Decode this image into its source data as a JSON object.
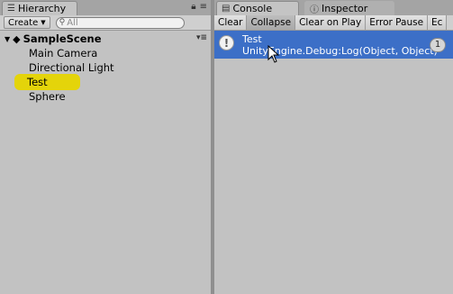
{
  "hierarchy": {
    "tab_label": "Hierarchy",
    "create_label": "Create",
    "search_placeholder": "All",
    "scene_name": "SampleScene",
    "items": [
      "Main Camera",
      "Directional Light",
      "Test",
      "Sphere"
    ],
    "selected_item": "Test"
  },
  "console": {
    "tab_label": "Console",
    "inspector_tab_label": "Inspector",
    "toolbar": [
      "Clear",
      "Collapse",
      "Clear on Play",
      "Error Pause",
      "Ec"
    ],
    "log": {
      "title": "Test",
      "detail": "UnityEngine.Debug:Log(Object, Object)",
      "count": "1"
    }
  },
  "colors": {
    "selection_highlight": "#e4d40a",
    "log_selected": "#3c6fc7"
  }
}
